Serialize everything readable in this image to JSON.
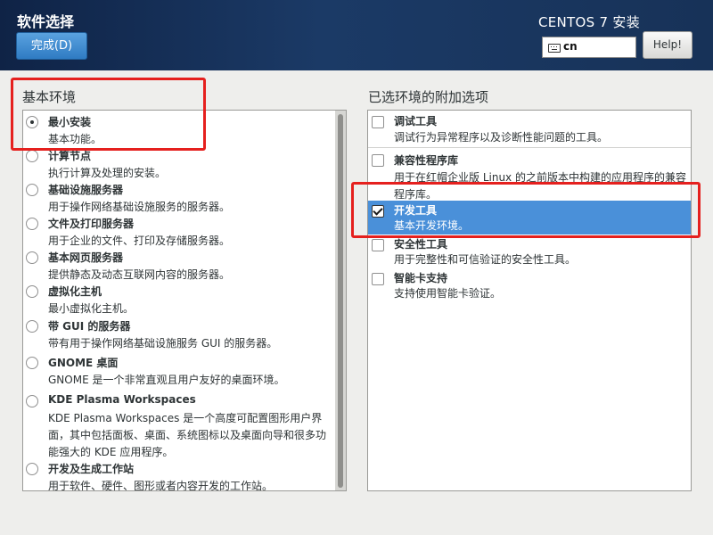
{
  "header": {
    "title": "软件选择",
    "done_label": "完成(D)",
    "product": "CENTOS 7 安装",
    "keyboard_layout": "cn",
    "help_label": "Help!"
  },
  "base_env": {
    "title": "基本环境",
    "items": [
      {
        "name": "最小安装",
        "desc": "基本功能。",
        "selected": true
      },
      {
        "name": "计算节点",
        "desc": "执行计算及处理的安装。",
        "selected": false
      },
      {
        "name": "基础设施服务器",
        "desc": "用于操作网络基础设施服务的服务器。",
        "selected": false
      },
      {
        "name": "文件及打印服务器",
        "desc": "用于企业的文件、打印及存储服务器。",
        "selected": false
      },
      {
        "name": "基本网页服务器",
        "desc": "提供静态及动态互联网内容的服务器。",
        "selected": false
      },
      {
        "name": "虚拟化主机",
        "desc": "最小虚拟化主机。",
        "selected": false
      },
      {
        "name": "带 GUI 的服务器",
        "desc": "带有用于操作网络基础设施服务 GUI 的服务器。",
        "selected": false
      },
      {
        "name": "GNOME 桌面",
        "desc": "GNOME 是一个非常直观且用户友好的桌面环境。",
        "selected": false
      },
      {
        "name": "KDE Plasma Workspaces",
        "desc": "KDE Plasma Workspaces 是一个高度可配置图形用户界面，其中包括面板、桌面、系统图标以及桌面向导和很多功能强大的 KDE 应用程序。",
        "selected": false
      },
      {
        "name": "开发及生成工作站",
        "desc": "用于软件、硬件、图形或者内容开发的工作站。",
        "selected": false
      }
    ]
  },
  "addons": {
    "title": "已选环境的附加选项",
    "items": [
      {
        "name": "调试工具",
        "desc": "调试行为异常程序以及诊断性能问题的工具。",
        "checked": false
      },
      {
        "name": "兼容性程序库",
        "desc": "用于在红帽企业版 Linux 的之前版本中构建的应用程序的兼容程序库。",
        "checked": false
      },
      {
        "name": "开发工具",
        "desc": "基本开发环境。",
        "checked": true
      },
      {
        "name": "安全性工具",
        "desc": "用于完整性和可信验证的安全性工具。",
        "checked": false
      },
      {
        "name": "智能卡支持",
        "desc": "支持使用智能卡验证。",
        "checked": false
      }
    ]
  },
  "colors": {
    "header_bg": "#1b3a66",
    "accent": "#4a90d9",
    "annotation": "#e5201e"
  }
}
